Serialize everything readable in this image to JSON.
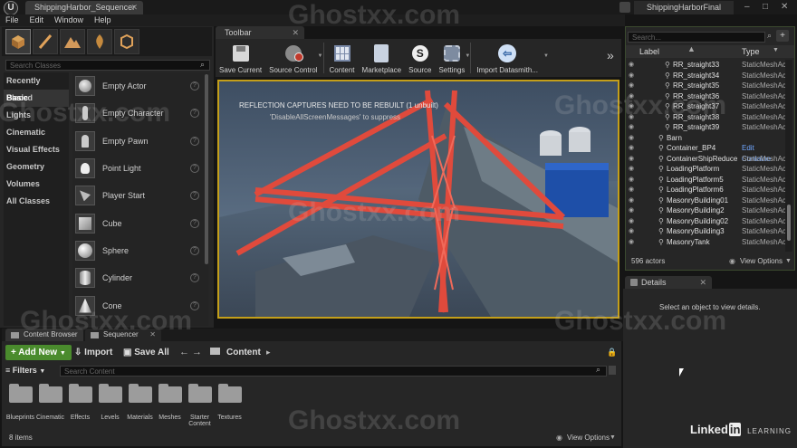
{
  "window": {
    "doc_tab": "ShippingHarbor_Sequencer",
    "project_name": "ShippingHarborFinal",
    "min": "–",
    "max": "□",
    "close": "✕",
    "doc_tab_close": "✕"
  },
  "menu": [
    "File",
    "Edit",
    "Window",
    "Help"
  ],
  "modes": {
    "search_placeholder": "Search Classes",
    "categories": [
      "Recently Placed",
      "Basic",
      "Lights",
      "Cinematic",
      "Visual Effects",
      "Geometry",
      "Volumes",
      "All Classes"
    ],
    "selected_category": "Basic",
    "items": [
      "Empty Actor",
      "Empty Character",
      "Empty Pawn",
      "Point Light",
      "Player Start",
      "Cube",
      "Sphere",
      "Cylinder",
      "Cone"
    ]
  },
  "toolbar": {
    "tab": "Toolbar",
    "buttons": [
      "Save Current",
      "Source Control",
      "Content",
      "Marketplace",
      "Source",
      "Settings",
      "Import Datasmith..."
    ],
    "more": "»"
  },
  "viewport": {
    "message1": "REFLECTION CAPTURES NEED TO BE REBUILT (1 unbuilt)",
    "message2": "'DisableAllScreenMessages' to suppress"
  },
  "outliner": {
    "search_placeholder": "Search...",
    "col_label": "Label",
    "col_type": "Type",
    "rows": [
      {
        "name": "RR_straight33",
        "type": "StaticMeshAc",
        "indent": 2
      },
      {
        "name": "RR_straight34",
        "type": "StaticMeshAc",
        "indent": 2
      },
      {
        "name": "RR_straight35",
        "type": "StaticMeshAc",
        "indent": 2
      },
      {
        "name": "RR_straight36",
        "type": "StaticMeshAc",
        "indent": 2
      },
      {
        "name": "RR_straight37",
        "type": "StaticMeshAc",
        "indent": 2
      },
      {
        "name": "RR_straight38",
        "type": "StaticMeshAc",
        "indent": 2
      },
      {
        "name": "RR_straight39",
        "type": "StaticMeshAc",
        "indent": 2
      },
      {
        "name": "Barn",
        "type": "",
        "indent": 1
      },
      {
        "name": "Container_BP4",
        "type": "Edit Containe",
        "indent": 1
      },
      {
        "name": "ContainerShipReduce",
        "type": "StaticMeshAc",
        "indent": 1
      },
      {
        "name": "LoadingPlatform",
        "type": "StaticMeshAc",
        "indent": 1
      },
      {
        "name": "LoadingPlatform5",
        "type": "StaticMeshAc",
        "indent": 1
      },
      {
        "name": "LoadingPlatform6",
        "type": "StaticMeshAc",
        "indent": 1
      },
      {
        "name": "MasonryBuilding01",
        "type": "StaticMeshAc",
        "indent": 1
      },
      {
        "name": "MasonryBuilding2",
        "type": "StaticMeshAc",
        "indent": 1
      },
      {
        "name": "MasonryBuilding02",
        "type": "StaticMeshAc",
        "indent": 1
      },
      {
        "name": "MasonryBuilding3",
        "type": "StaticMeshAc",
        "indent": 1
      },
      {
        "name": "MasonryTank",
        "type": "StaticMeshAc",
        "indent": 1
      }
    ],
    "actor_count": "596 actors",
    "view_options": "View Options"
  },
  "details": {
    "tab": "Details",
    "empty_text": "Select an object to view details."
  },
  "content_browser": {
    "tab1": "Content Browser",
    "tab2": "Sequencer",
    "add_new": "Add New",
    "import": "Import",
    "save_all": "Save All",
    "path": "Content",
    "filters": "Filters",
    "search_placeholder": "Search Content",
    "folders": [
      "Blueprints",
      "Cinematic",
      "Effects",
      "Levels",
      "Materials",
      "Meshes",
      "Starter Content",
      "Textures"
    ],
    "item_count": "8 items",
    "view_options": "View Options"
  },
  "brand": {
    "linkedin_text": "Linked",
    "linkedin_in": "in",
    "learning": "LEARNING"
  },
  "watermark": "Ghostxx.com",
  "colors": {
    "accent_green": "#4a8b2d",
    "viewport_border": "#c49f1a",
    "crane_red": "#e04a3c"
  }
}
